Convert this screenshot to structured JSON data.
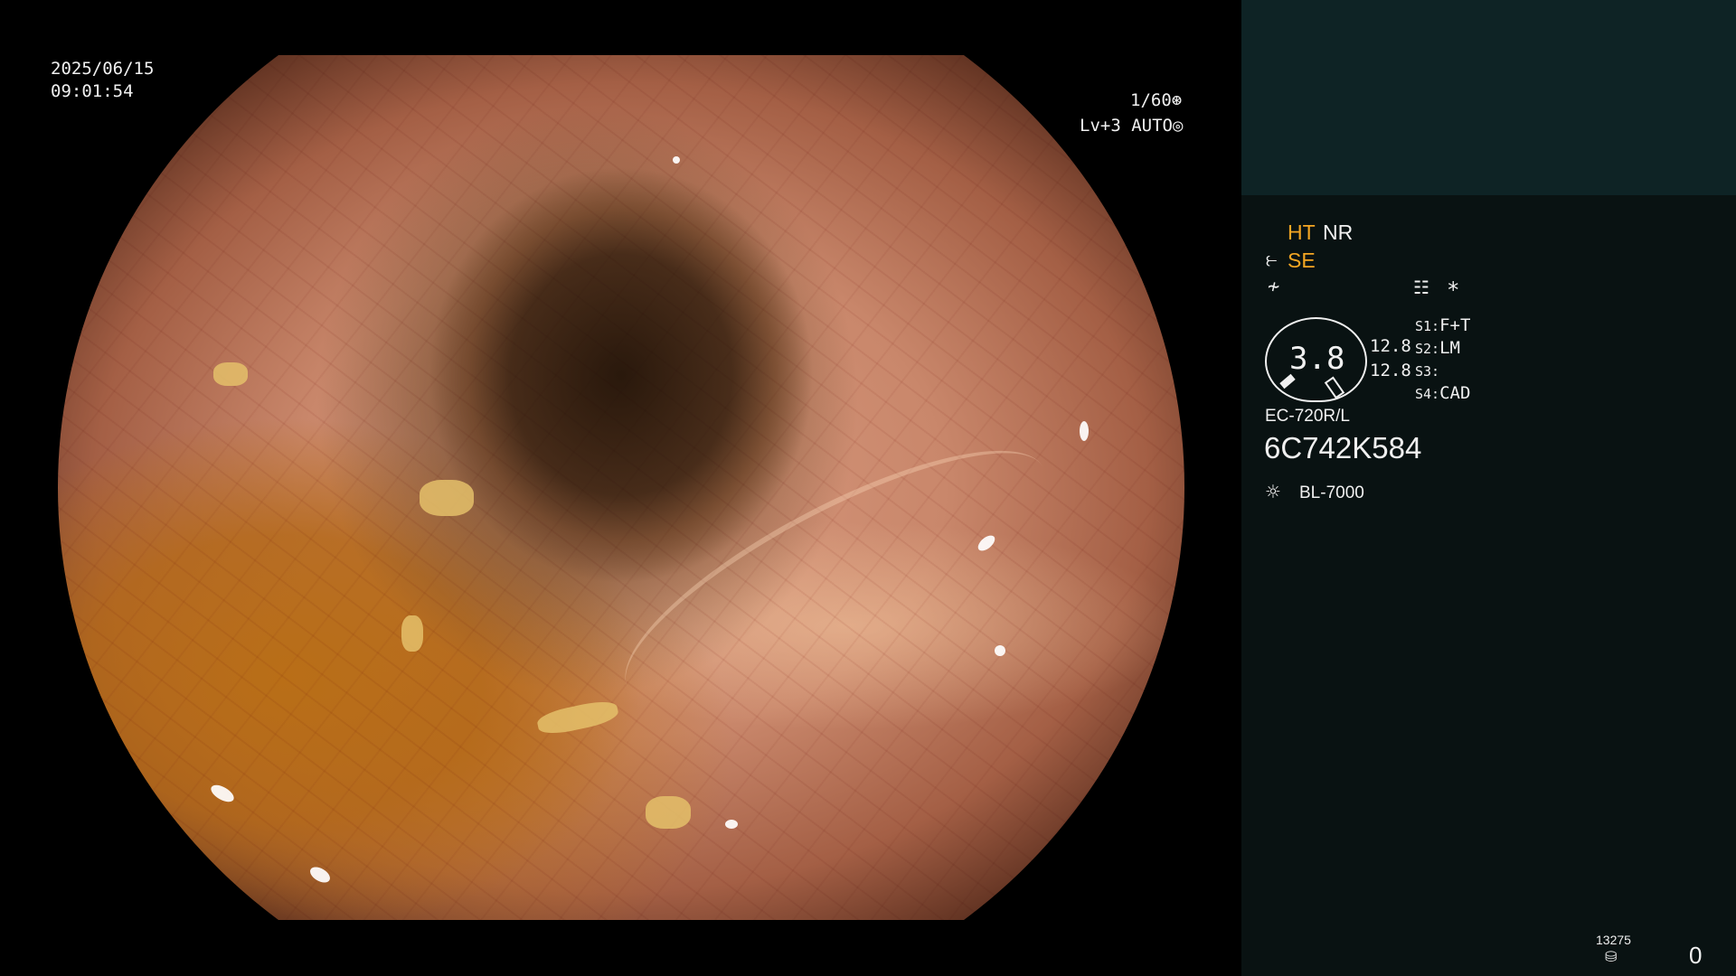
{
  "overlay": {
    "date": "2025/06/15",
    "time": "09:01:54",
    "shutter": "1/60",
    "shutter_icon": "shutter-icon",
    "iris": "Lv+3 AUTO",
    "iris_icon": "iris-icon"
  },
  "panel": {
    "modes": {
      "ht": "HT",
      "nr": "NR",
      "se": "SE"
    },
    "mode_colors": {
      "active": "#f5a623",
      "normal": "#f0f0f0"
    },
    "icons": [
      "structure-enhance-icon",
      "freeze-icon",
      "record-icon",
      "asterisk-icon",
      "light-source-icon",
      "capture-icon"
    ],
    "asterisk": "*",
    "gauge": {
      "value": "3.8"
    },
    "readings": [
      "12.8",
      "12.8"
    ],
    "switches": [
      {
        "key": "S1:",
        "value": "F+T"
      },
      {
        "key": "S2:",
        "value": "LM"
      },
      {
        "key": "S3:",
        "value": ""
      },
      {
        "key": "S4:",
        "value": "CAD"
      }
    ],
    "scope_model": "EC-720R/L",
    "serial": "6C742K584",
    "light_source": "BL-7000",
    "capture_count": "13275",
    "counter": "0",
    "colors": {
      "header": "#0e2325",
      "background": "#091212"
    }
  }
}
